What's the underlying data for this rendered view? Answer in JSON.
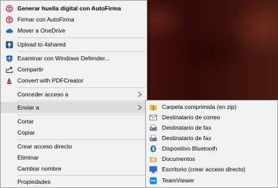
{
  "main_menu": {
    "items": [
      {
        "label": "Generar huella digital con AutoFirma",
        "icon": "autofirma-icon"
      },
      {
        "label": "Firmar con AutoFirma",
        "icon": "autofirma-icon"
      },
      {
        "label": "Mover a OneDrive",
        "icon": "onedrive-cloud-icon"
      },
      {
        "label": "Upload to 4shared",
        "icon": "4shared-icon"
      },
      {
        "label": "Examinar con Windows Defender...",
        "icon": "windows-defender-icon"
      },
      {
        "label": "Compartir",
        "icon": "share-icon"
      },
      {
        "label": "Convert with PDFCreator",
        "icon": "pdfcreator-icon"
      },
      {
        "label": "Conceder acceso a"
      },
      {
        "label": "Enviar a"
      },
      {
        "label": "Cortar"
      },
      {
        "label": "Copiar"
      },
      {
        "label": "Crear acceso directo"
      },
      {
        "label": "Eliminar"
      },
      {
        "label": "Cambiar nombre"
      },
      {
        "label": "Propiedades"
      }
    ]
  },
  "send_to_menu": {
    "items": [
      {
        "label": "Carpeta comprimida (en zip)",
        "icon": "zip-folder-icon"
      },
      {
        "label": "Destinatario de correo",
        "icon": "mail-recipient-icon"
      },
      {
        "label": "Destinatario de fax",
        "icon": "fax-recipient-icon"
      },
      {
        "label": "Destinatario de fax",
        "icon": "fax-recipient-icon"
      },
      {
        "label": "Dispositivo Bluetooth",
        "icon": "bluetooth-icon"
      },
      {
        "label": "Documentos",
        "icon": "documents-folder-icon"
      },
      {
        "label": "Escritorio (crear acceso directo)",
        "icon": "desktop-icon"
      },
      {
        "label": "TeamViewer",
        "icon": "teamviewer-icon"
      }
    ]
  },
  "colors": {
    "menu_bg": "#f2f2f2",
    "highlight": "#dcdcdc",
    "separator": "#cfcfcf",
    "autofirma_red": "#d4232b",
    "onedrive_blue": "#1c6cc8",
    "teamviewer_blue": "#0e8ee9"
  }
}
